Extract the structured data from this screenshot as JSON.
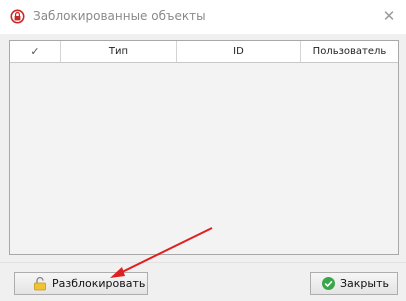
{
  "window": {
    "title": "Заблокированные объекты",
    "close_glyph": "✕"
  },
  "grid": {
    "columns": [
      "✓",
      "Тип",
      "ID",
      "Пользователь"
    ],
    "rows": []
  },
  "buttons": {
    "unlock_label": "Разблокировать",
    "close_label": "Закрыть"
  },
  "icons": {
    "title": "lock-target-icon",
    "unlock": "open-padlock-icon",
    "close": "green-check-circle-icon"
  },
  "colors": {
    "arrow": "#e02020",
    "title_icon": "#c82828",
    "check_green": "#3aa64a",
    "padlock": "#f1c232"
  }
}
